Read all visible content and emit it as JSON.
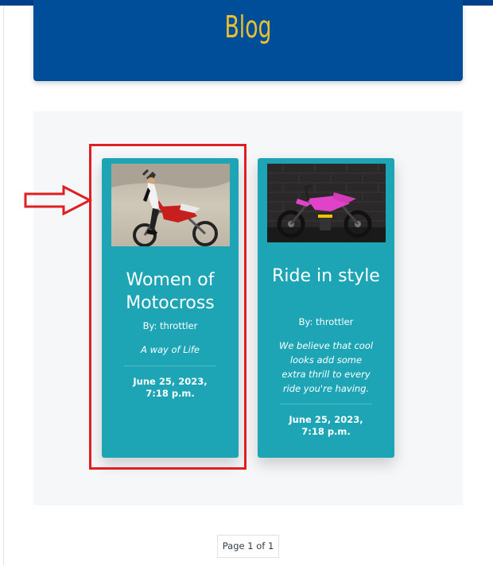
{
  "header": {
    "title": "Blog"
  },
  "posts": [
    {
      "title": "Women of Motocross",
      "author": "By: throttler",
      "description": "A way of Life",
      "date": "June 25, 2023, 7:18 p.m.",
      "image_alt": "woman-with-dirt-bike"
    },
    {
      "title": "Ride in style",
      "author": "By: throttler",
      "description": "We believe that cool looks add some extra thrill to every ride you're having.",
      "date": "June 25, 2023, 7:18 p.m.",
      "image_alt": "pink-dirt-bike"
    }
  ],
  "pagination": {
    "label": "Page 1 of 1"
  },
  "colors": {
    "header_bg": "#004d99",
    "title_color": "#e8c12e",
    "card_bg": "#1da5b6",
    "annotation_red": "#e02020"
  }
}
